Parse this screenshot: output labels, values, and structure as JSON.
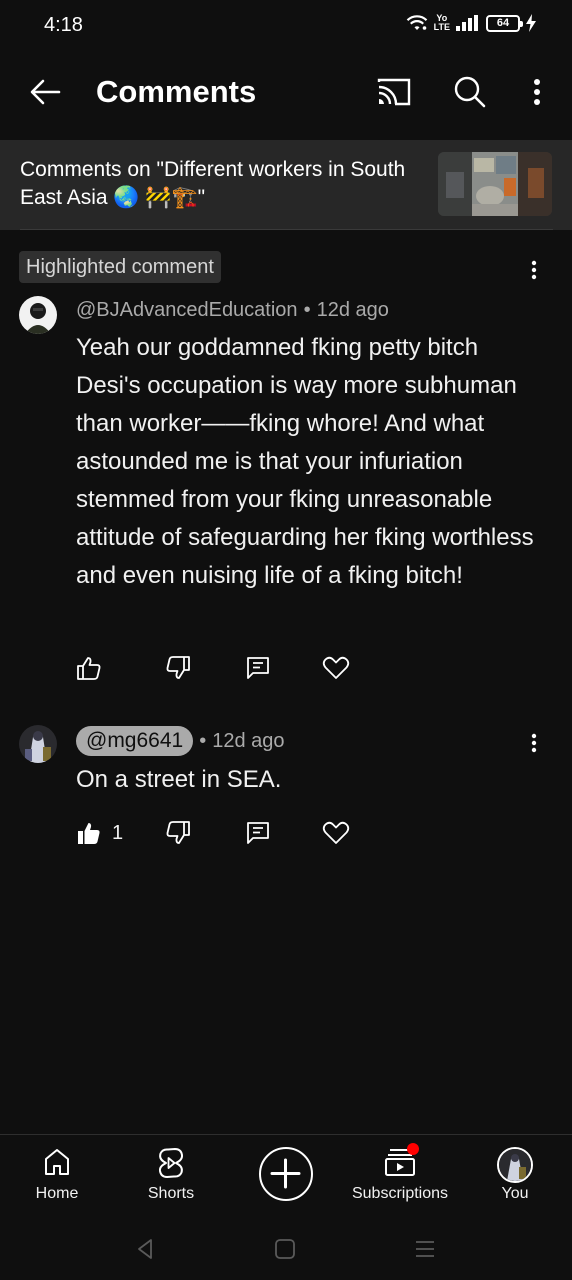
{
  "status_bar": {
    "time": "4:18",
    "volte_line1": "Yo",
    "volte_line2": "LTE",
    "battery": "64"
  },
  "app_bar": {
    "title": "Comments",
    "icons": [
      "back-arrow-icon",
      "cast-icon",
      "search-icon",
      "more-vert-icon"
    ]
  },
  "video": {
    "context_title": "Comments on \"Different workers in South East Asia 🌏 🚧🏗️\""
  },
  "comments": [
    {
      "highlight_label": "Highlighted comment",
      "author": "@BJAdvancedEducation",
      "time": "12d ago",
      "text": "Yeah our goddamned fking petty bitch Desi's occupation is way more subhuman than worker——fking whore! And what astounded me is that your infuriation stemmed from your fking unreasonable attitude of safeguarding her fking worthless and even nuising life of a fking bitch!",
      "likes": "",
      "liked": false
    },
    {
      "author": "@mg6641",
      "time": "12d ago",
      "text": "On a street in SEA.",
      "likes": "1",
      "liked": true
    }
  ],
  "separator": "•",
  "bottom_nav": {
    "items": [
      {
        "label": "Home",
        "icon": "home-icon"
      },
      {
        "label": "Shorts",
        "icon": "shorts-icon"
      },
      {
        "label": "",
        "icon": "create-icon"
      },
      {
        "label": "Subscriptions",
        "icon": "subscriptions-icon",
        "badge": true
      },
      {
        "label": "You",
        "icon": "avatar"
      }
    ]
  },
  "colors": {
    "background": "#0f0f0f",
    "banner": "#272727",
    "secondary_text": "#aaaaaa",
    "notification": "#ff0000"
  }
}
